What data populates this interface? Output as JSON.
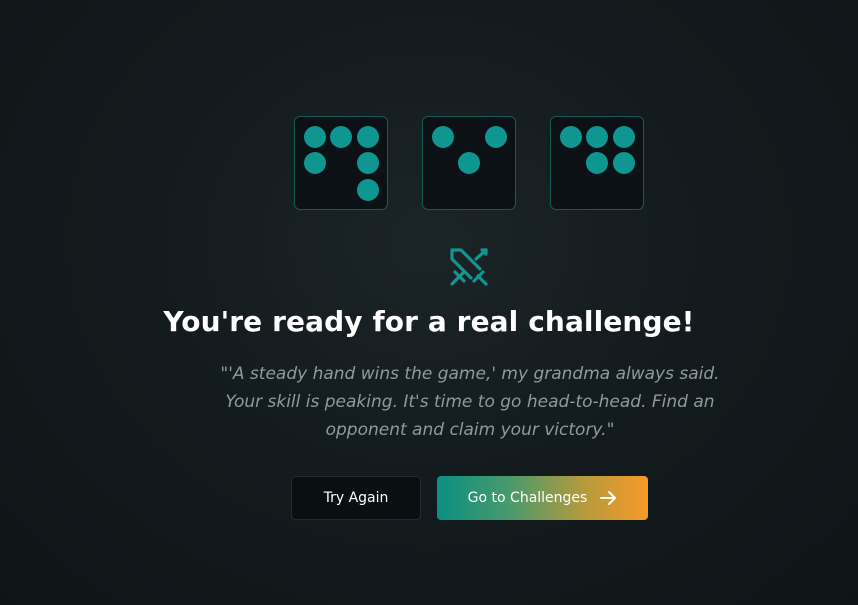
{
  "dice": [
    {
      "label": "die-1",
      "pips": 6
    },
    {
      "label": "die-2",
      "pips": 3
    },
    {
      "label": "die-3",
      "pips": 5
    }
  ],
  "icon": "crossed-swords-icon",
  "headline": "You're ready for a real challenge!",
  "quote": "\"'A steady hand wins the game,' my grandma always said. Your skill is peaking. It's time to go head-to-head. Find an opponent and claim your victory.\"",
  "actions": {
    "try_again": "Try Again",
    "go_to_challenges": "Go to Challenges",
    "go_icon": "arrow-right-icon"
  },
  "colors": {
    "accent_teal": "#0f9690",
    "accent_orange": "#f79a2a",
    "background": "#141b1e"
  }
}
